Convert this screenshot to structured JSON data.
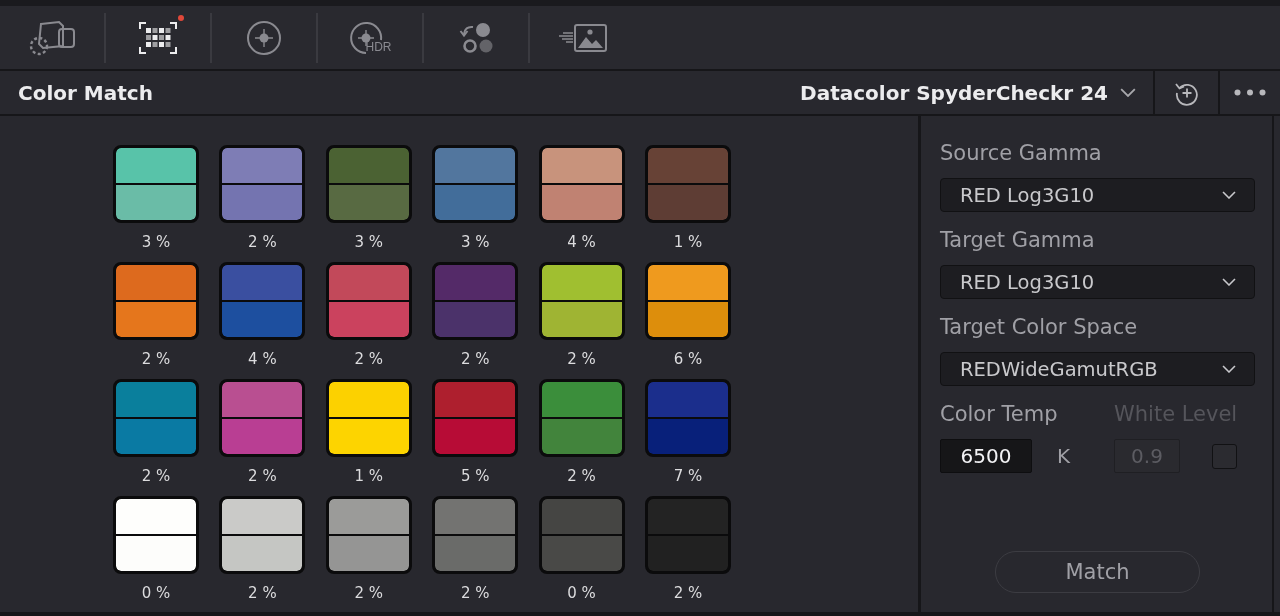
{
  "toolbar": {
    "tools": [
      {
        "kind": "camera",
        "selected": false,
        "badge": false
      },
      {
        "kind": "chart",
        "selected": true,
        "badge": true
      },
      {
        "kind": "target",
        "selected": false,
        "badge": false
      },
      {
        "kind": "hdr",
        "label": "HDR",
        "selected": false,
        "badge": false
      },
      {
        "kind": "circles",
        "selected": false,
        "badge": false
      },
      {
        "kind": "image",
        "selected": false,
        "badge": false
      }
    ]
  },
  "header": {
    "title": "Color Match",
    "chart": "Datacolor SpyderCheckr 24"
  },
  "patches": [
    {
      "halves": [
        {
          "color": "#58c3a9"
        },
        {
          "color": "#6abca7"
        }
      ],
      "reading": "3 %"
    },
    {
      "halves": [
        {
          "color": "#7e7db5"
        },
        {
          "color": "#7474b0"
        }
      ],
      "reading": "2 %"
    },
    {
      "halves": [
        {
          "color": "#4b6233"
        },
        {
          "color": "#586a42"
        }
      ],
      "reading": "3 %"
    },
    {
      "halves": [
        {
          "color": "#52769e"
        },
        {
          "color": "#426d9a"
        }
      ],
      "reading": "3 %"
    },
    {
      "halves": [
        {
          "color": "#c8937c"
        },
        {
          "color": "#c08272"
        }
      ],
      "reading": "4 %"
    },
    {
      "halves": [
        {
          "color": "#674236"
        },
        {
          "color": "#5e3d34"
        }
      ],
      "reading": "1 %"
    },
    {
      "halves": [
        {
          "color": "#dd6a1e"
        },
        {
          "color": "#e5761c"
        }
      ],
      "reading": "2 %"
    },
    {
      "halves": [
        {
          "color": "#3a4fa0"
        },
        {
          "color": "#1d4f9f"
        }
      ],
      "reading": "4 %"
    },
    {
      "halves": [
        {
          "color": "#c2495a"
        },
        {
          "color": "#cb425e"
        }
      ],
      "reading": "2 %"
    },
    {
      "halves": [
        {
          "color": "#542a68"
        },
        {
          "color": "#4b326a"
        }
      ],
      "reading": "2 %"
    },
    {
      "halves": [
        {
          "color": "#a0bf30"
        },
        {
          "color": "#9fb433"
        }
      ],
      "reading": "2 %"
    },
    {
      "halves": [
        {
          "color": "#ef9a1e"
        },
        {
          "color": "#dd8e0c"
        }
      ],
      "reading": "6 %"
    },
    {
      "halves": [
        {
          "color": "#0a7f9c"
        },
        {
          "color": "#0a7aa3"
        }
      ],
      "reading": "2 %"
    },
    {
      "halves": [
        {
          "color": "#b94f91"
        },
        {
          "color": "#b93e93"
        }
      ],
      "reading": "2 %"
    },
    {
      "halves": [
        {
          "color": "#fcd100"
        },
        {
          "color": "#fdd400"
        }
      ],
      "reading": "1 %"
    },
    {
      "halves": [
        {
          "color": "#ae1f2e"
        },
        {
          "color": "#b70c36"
        }
      ],
      "reading": "5 %"
    },
    {
      "halves": [
        {
          "color": "#3b8e3b"
        },
        {
          "color": "#42843c"
        }
      ],
      "reading": "2 %"
    },
    {
      "halves": [
        {
          "color": "#1b2e8c"
        },
        {
          "color": "#08207a"
        }
      ],
      "reading": "7 %"
    },
    {
      "halves": [
        {
          "color": "#fefefc"
        },
        {
          "color": "#fdfdfb"
        }
      ],
      "reading": "0 %"
    },
    {
      "halves": [
        {
          "color": "#cacac8"
        },
        {
          "color": "#c5c6c3"
        }
      ],
      "reading": "2 %"
    },
    {
      "halves": [
        {
          "color": "#9b9b99"
        },
        {
          "color": "#959594"
        }
      ],
      "reading": "2 %"
    },
    {
      "halves": [
        {
          "color": "#737371"
        },
        {
          "color": "#6a6b69"
        }
      ],
      "reading": "2 %"
    },
    {
      "halves": [
        {
          "color": "#454543"
        },
        {
          "color": "#494947"
        }
      ],
      "reading": "0 %"
    },
    {
      "halves": [
        {
          "color": "#232323"
        },
        {
          "color": "#212121"
        }
      ],
      "reading": "2 %"
    }
  ],
  "settings": {
    "dropdowns": [
      {
        "label": "Source Gamma",
        "value": "RED Log3G10"
      },
      {
        "label": "Target Gamma",
        "value": "RED Log3G10"
      },
      {
        "label": "Target Color Space",
        "value": "REDWideGamutRGB"
      }
    ],
    "color_temp": {
      "label": "Color Temp",
      "value": "6500",
      "unit": "K"
    },
    "white_level": {
      "label": "White Level",
      "value": "0.9",
      "disabled": true,
      "checked": false
    }
  },
  "match_button": {
    "label": "Match"
  }
}
